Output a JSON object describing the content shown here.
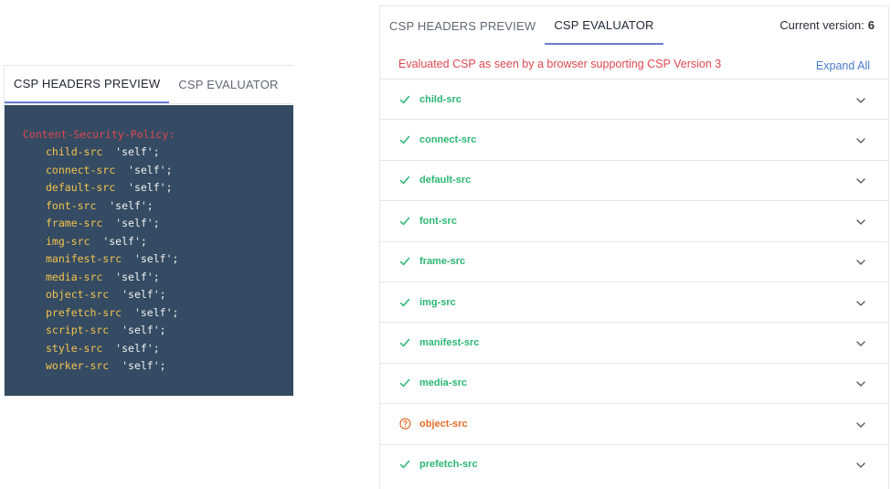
{
  "left_panel": {
    "tabs": [
      {
        "label": "CSP HEADERS PREVIEW",
        "active": true
      },
      {
        "label": "CSP EVALUATOR",
        "active": false
      }
    ],
    "header_name": "Content-Security-Policy:",
    "directives": [
      {
        "name": "child-src",
        "value": "'self';"
      },
      {
        "name": "connect-src",
        "value": "'self';"
      },
      {
        "name": "default-src",
        "value": "'self';"
      },
      {
        "name": "font-src",
        "value": "'self';"
      },
      {
        "name": "frame-src",
        "value": "'self';"
      },
      {
        "name": "img-src",
        "value": "'self';"
      },
      {
        "name": "manifest-src",
        "value": "'self';"
      },
      {
        "name": "media-src",
        "value": "'self';"
      },
      {
        "name": "object-src",
        "value": "'self';"
      },
      {
        "name": "prefetch-src",
        "value": "'self';"
      },
      {
        "name": "script-src",
        "value": "'self';"
      },
      {
        "name": "style-src",
        "value": "'self';"
      },
      {
        "name": "worker-src",
        "value": "'self';"
      }
    ]
  },
  "right_panel": {
    "tabs": [
      {
        "label": "CSP HEADERS PREVIEW",
        "active": false
      },
      {
        "label": "CSP EVALUATOR",
        "active": true
      }
    ],
    "version_label": "Current version:",
    "version_value": "6",
    "eval_message": "Evaluated CSP as seen by a browser supporting CSP Version 3",
    "expand_all_label": "Expand All",
    "rows": [
      {
        "label": "child-src",
        "status": "ok"
      },
      {
        "label": "connect-src",
        "status": "ok"
      },
      {
        "label": "default-src",
        "status": "ok"
      },
      {
        "label": "font-src",
        "status": "ok"
      },
      {
        "label": "frame-src",
        "status": "ok"
      },
      {
        "label": "img-src",
        "status": "ok"
      },
      {
        "label": "manifest-src",
        "status": "ok"
      },
      {
        "label": "media-src",
        "status": "ok"
      },
      {
        "label": "object-src",
        "status": "warning"
      },
      {
        "label": "prefetch-src",
        "status": "ok"
      }
    ]
  },
  "colors": {
    "code_background": "#344b63",
    "header_name": "#e0484f",
    "directive_name": "#f5c34d",
    "ok_green": "#2bb673",
    "warning_orange": "#e46f2a",
    "link_blue": "#4a7bd1",
    "tab_underline": "#6b7cd1"
  },
  "icons": {
    "ok": "check-icon",
    "warning": "question-circle-icon",
    "expand": "chevron-down-icon"
  }
}
